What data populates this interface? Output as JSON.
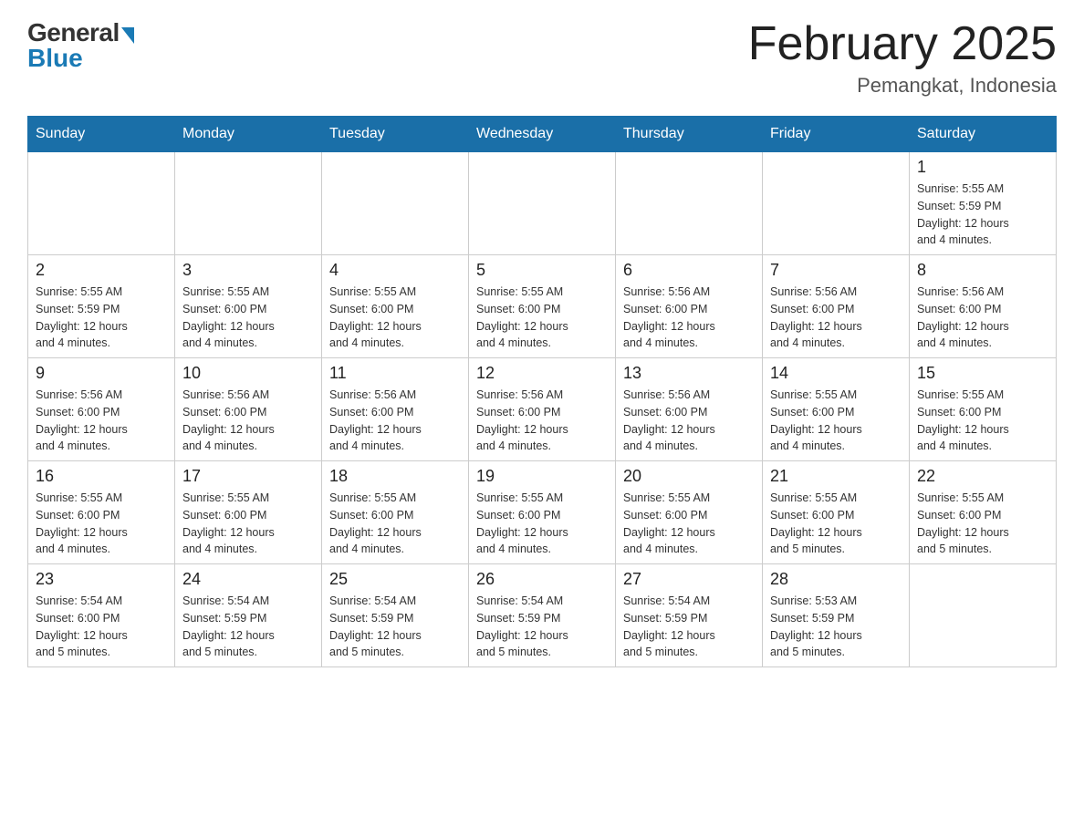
{
  "logo": {
    "general": "General",
    "blue": "Blue"
  },
  "title": {
    "month_year": "February 2025",
    "location": "Pemangkat, Indonesia"
  },
  "header_days": [
    "Sunday",
    "Monday",
    "Tuesday",
    "Wednesday",
    "Thursday",
    "Friday",
    "Saturday"
  ],
  "weeks": [
    {
      "days": [
        {
          "number": "",
          "info": ""
        },
        {
          "number": "",
          "info": ""
        },
        {
          "number": "",
          "info": ""
        },
        {
          "number": "",
          "info": ""
        },
        {
          "number": "",
          "info": ""
        },
        {
          "number": "",
          "info": ""
        },
        {
          "number": "1",
          "info": "Sunrise: 5:55 AM\nSunset: 5:59 PM\nDaylight: 12 hours\nand 4 minutes."
        }
      ]
    },
    {
      "days": [
        {
          "number": "2",
          "info": "Sunrise: 5:55 AM\nSunset: 5:59 PM\nDaylight: 12 hours\nand 4 minutes."
        },
        {
          "number": "3",
          "info": "Sunrise: 5:55 AM\nSunset: 6:00 PM\nDaylight: 12 hours\nand 4 minutes."
        },
        {
          "number": "4",
          "info": "Sunrise: 5:55 AM\nSunset: 6:00 PM\nDaylight: 12 hours\nand 4 minutes."
        },
        {
          "number": "5",
          "info": "Sunrise: 5:55 AM\nSunset: 6:00 PM\nDaylight: 12 hours\nand 4 minutes."
        },
        {
          "number": "6",
          "info": "Sunrise: 5:56 AM\nSunset: 6:00 PM\nDaylight: 12 hours\nand 4 minutes."
        },
        {
          "number": "7",
          "info": "Sunrise: 5:56 AM\nSunset: 6:00 PM\nDaylight: 12 hours\nand 4 minutes."
        },
        {
          "number": "8",
          "info": "Sunrise: 5:56 AM\nSunset: 6:00 PM\nDaylight: 12 hours\nand 4 minutes."
        }
      ]
    },
    {
      "days": [
        {
          "number": "9",
          "info": "Sunrise: 5:56 AM\nSunset: 6:00 PM\nDaylight: 12 hours\nand 4 minutes."
        },
        {
          "number": "10",
          "info": "Sunrise: 5:56 AM\nSunset: 6:00 PM\nDaylight: 12 hours\nand 4 minutes."
        },
        {
          "number": "11",
          "info": "Sunrise: 5:56 AM\nSunset: 6:00 PM\nDaylight: 12 hours\nand 4 minutes."
        },
        {
          "number": "12",
          "info": "Sunrise: 5:56 AM\nSunset: 6:00 PM\nDaylight: 12 hours\nand 4 minutes."
        },
        {
          "number": "13",
          "info": "Sunrise: 5:56 AM\nSunset: 6:00 PM\nDaylight: 12 hours\nand 4 minutes."
        },
        {
          "number": "14",
          "info": "Sunrise: 5:55 AM\nSunset: 6:00 PM\nDaylight: 12 hours\nand 4 minutes."
        },
        {
          "number": "15",
          "info": "Sunrise: 5:55 AM\nSunset: 6:00 PM\nDaylight: 12 hours\nand 4 minutes."
        }
      ]
    },
    {
      "days": [
        {
          "number": "16",
          "info": "Sunrise: 5:55 AM\nSunset: 6:00 PM\nDaylight: 12 hours\nand 4 minutes."
        },
        {
          "number": "17",
          "info": "Sunrise: 5:55 AM\nSunset: 6:00 PM\nDaylight: 12 hours\nand 4 minutes."
        },
        {
          "number": "18",
          "info": "Sunrise: 5:55 AM\nSunset: 6:00 PM\nDaylight: 12 hours\nand 4 minutes."
        },
        {
          "number": "19",
          "info": "Sunrise: 5:55 AM\nSunset: 6:00 PM\nDaylight: 12 hours\nand 4 minutes."
        },
        {
          "number": "20",
          "info": "Sunrise: 5:55 AM\nSunset: 6:00 PM\nDaylight: 12 hours\nand 4 minutes."
        },
        {
          "number": "21",
          "info": "Sunrise: 5:55 AM\nSunset: 6:00 PM\nDaylight: 12 hours\nand 5 minutes."
        },
        {
          "number": "22",
          "info": "Sunrise: 5:55 AM\nSunset: 6:00 PM\nDaylight: 12 hours\nand 5 minutes."
        }
      ]
    },
    {
      "days": [
        {
          "number": "23",
          "info": "Sunrise: 5:54 AM\nSunset: 6:00 PM\nDaylight: 12 hours\nand 5 minutes."
        },
        {
          "number": "24",
          "info": "Sunrise: 5:54 AM\nSunset: 5:59 PM\nDaylight: 12 hours\nand 5 minutes."
        },
        {
          "number": "25",
          "info": "Sunrise: 5:54 AM\nSunset: 5:59 PM\nDaylight: 12 hours\nand 5 minutes."
        },
        {
          "number": "26",
          "info": "Sunrise: 5:54 AM\nSunset: 5:59 PM\nDaylight: 12 hours\nand 5 minutes."
        },
        {
          "number": "27",
          "info": "Sunrise: 5:54 AM\nSunset: 5:59 PM\nDaylight: 12 hours\nand 5 minutes."
        },
        {
          "number": "28",
          "info": "Sunrise: 5:53 AM\nSunset: 5:59 PM\nDaylight: 12 hours\nand 5 minutes."
        },
        {
          "number": "",
          "info": ""
        }
      ]
    }
  ]
}
